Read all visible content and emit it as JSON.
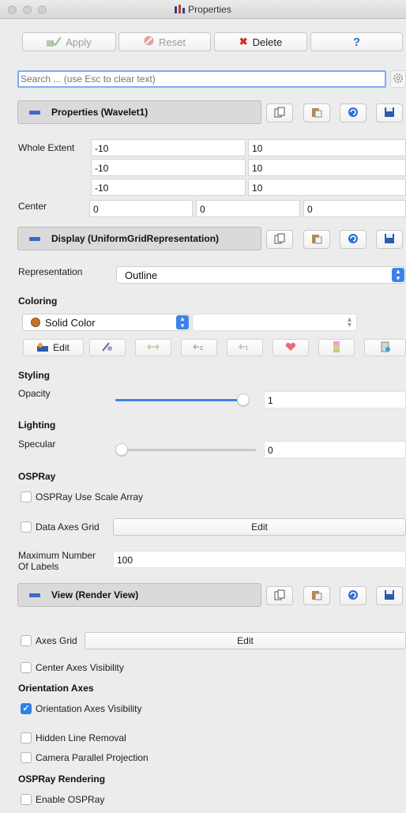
{
  "window": {
    "title": "Properties"
  },
  "toolbar": {
    "apply_label": "Apply",
    "reset_label": "Reset",
    "delete_label": "Delete",
    "help_label": "?"
  },
  "search": {
    "placeholder": "Search ... (use Esc to clear text)"
  },
  "properties_panel": {
    "title": "Properties (Wavelet1)",
    "whole_extent_label": "Whole Extent",
    "whole_extent": [
      [
        "-10",
        "10"
      ],
      [
        "-10",
        "10"
      ],
      [
        "-10",
        "10"
      ]
    ],
    "center_label": "Center",
    "center": [
      "0",
      "0",
      "0"
    ]
  },
  "display_panel": {
    "title": "Display (UniformGridRepresentation)",
    "representation_label": "Representation",
    "representation_value": "Outline",
    "coloring_label": "Coloring",
    "coloring_value": "Solid Color",
    "edit_label": "Edit",
    "styling_label": "Styling",
    "opacity_label": "Opacity",
    "opacity_value": "1",
    "opacity_fraction": 1.0,
    "lighting_label": "Lighting",
    "specular_label": "Specular",
    "specular_value": "0",
    "specular_fraction": 0.0,
    "ospray_label": "OSPRay",
    "ospray_scale_label": "OSPRay Use Scale Array",
    "data_axes_grid_label": "Data Axes Grid",
    "data_axes_grid_edit": "Edit",
    "max_labels_label_line1": "Maximum Number",
    "max_labels_label_line2": "Of Labels",
    "max_labels_value": "100"
  },
  "view_panel": {
    "title": "View (Render View)",
    "axes_grid_label": "Axes Grid",
    "axes_grid_edit": "Edit",
    "center_axes_label": "Center Axes Visibility",
    "orientation_axes_section": "Orientation Axes",
    "orientation_axes_visibility_label": "Orientation Axes Visibility",
    "orientation_axes_checked": true,
    "hidden_line_label": "Hidden Line Removal",
    "camera_parallel_label": "Camera Parallel Projection",
    "ospray_rendering_section": "OSPRay Rendering",
    "enable_ospray_label": "Enable OSPRay"
  },
  "colors": {
    "accent": "#3b82e8",
    "header_dash": "#3d6ac9",
    "solid_color_swatch": "#c7742e",
    "delete_red": "#d32f1f"
  }
}
